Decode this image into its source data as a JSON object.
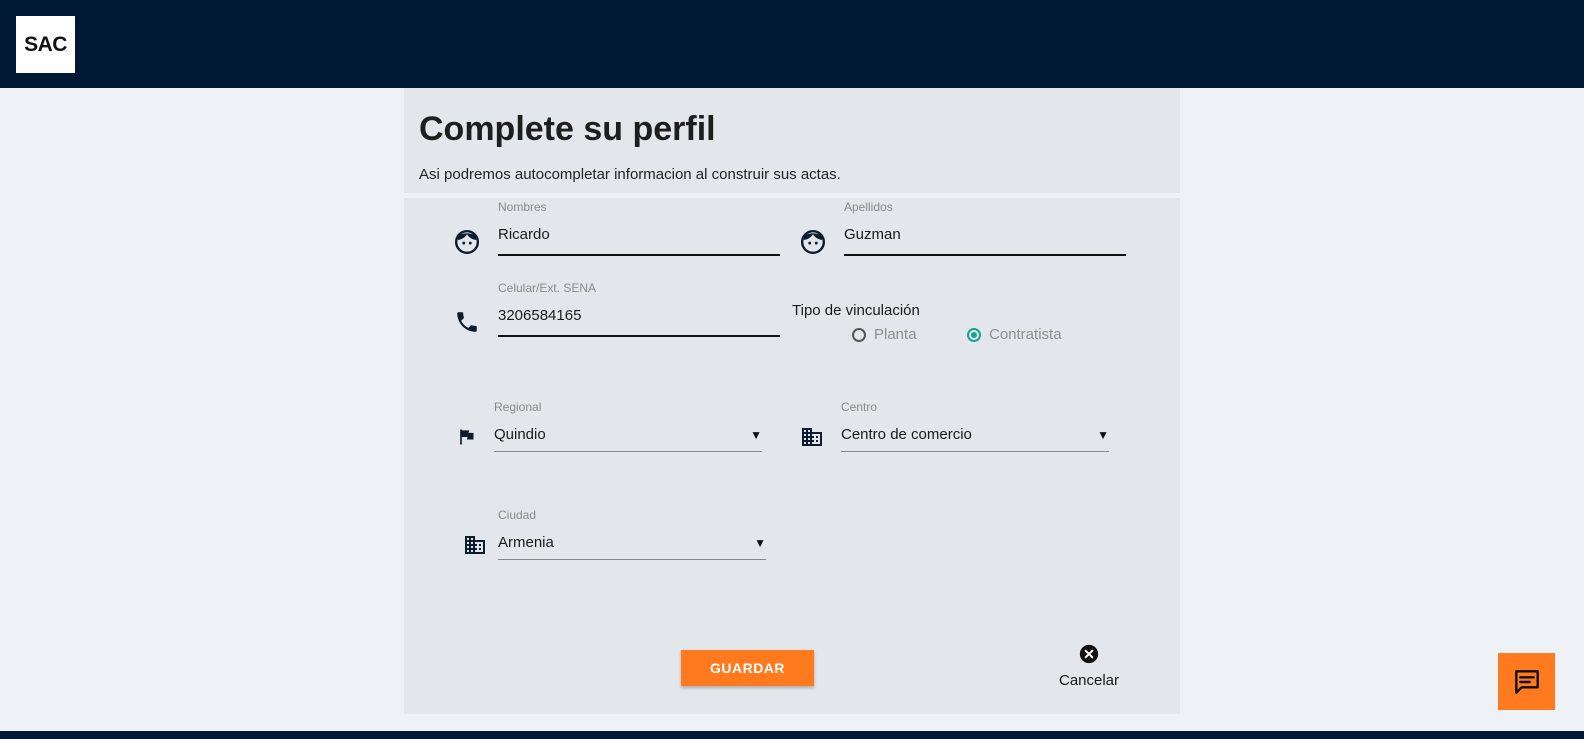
{
  "app": {
    "logo_text": "SAC"
  },
  "header": {
    "title": "Complete su perfil",
    "subtitle": "Asi podremos autocompletar informacion al construir sus actas."
  },
  "form": {
    "nombres": {
      "label": "Nombres",
      "value": "Ricardo",
      "icon": "face-icon"
    },
    "apellidos": {
      "label": "Apellidos",
      "value": "Guzman",
      "icon": "face-icon"
    },
    "celular": {
      "label": "Celular/Ext. SENA",
      "value": "3206584165",
      "icon": "phone-icon"
    },
    "vinculacion": {
      "title": "Tipo de vinculación",
      "options": [
        {
          "label": "Planta",
          "selected": false
        },
        {
          "label": "Contratista",
          "selected": true
        }
      ]
    },
    "regional": {
      "label": "Regional",
      "value": "Quindio",
      "icon": "flag-icon"
    },
    "centro": {
      "label": "Centro",
      "value": "Centro de comercio",
      "icon": "building-icon"
    },
    "ciudad": {
      "label": "Ciudad",
      "value": "Armenia",
      "icon": "building-icon"
    },
    "dropdown_arrow": "▼"
  },
  "actions": {
    "save_label": "GUARDAR",
    "cancel_label": "Cancelar"
  },
  "colors": {
    "topbar": "#001a36",
    "accent": "#ff7a1f",
    "radio_selected": "#1aa394",
    "panel": "#e3e6ea",
    "background": "#eef1f5"
  }
}
